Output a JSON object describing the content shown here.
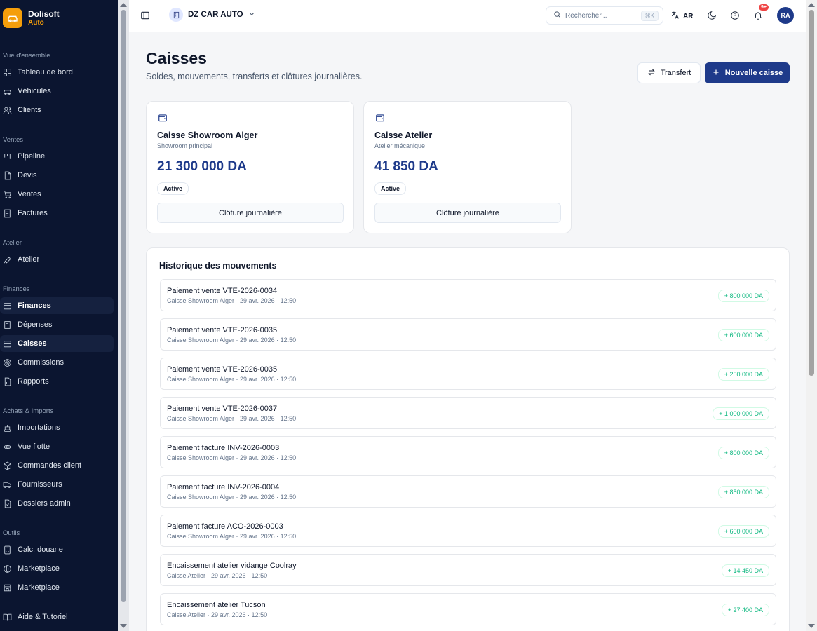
{
  "brand": {
    "name": "Dolisoft",
    "product": "Auto"
  },
  "sidebar": {
    "sections": [
      {
        "label": "Vue d'ensemble",
        "items": [
          {
            "label": "Tableau de bord",
            "icon": "dashboard-icon"
          },
          {
            "label": "Véhicules",
            "icon": "car-icon"
          },
          {
            "label": "Clients",
            "icon": "users-icon"
          }
        ]
      },
      {
        "label": "Ventes",
        "items": [
          {
            "label": "Pipeline",
            "icon": "pipeline-icon"
          },
          {
            "label": "Devis",
            "icon": "file-icon"
          },
          {
            "label": "Ventes",
            "icon": "cart-icon"
          },
          {
            "label": "Factures",
            "icon": "invoice-icon"
          }
        ]
      },
      {
        "label": "Atelier",
        "items": [
          {
            "label": "Atelier",
            "icon": "wrench-icon"
          }
        ]
      },
      {
        "label": "Finances",
        "items": [
          {
            "label": "Finances",
            "icon": "wallet-icon"
          },
          {
            "label": "Dépenses",
            "icon": "receipt-icon"
          },
          {
            "label": "Caisses",
            "icon": "cashbox-icon"
          },
          {
            "label": "Commissions",
            "icon": "target-icon"
          },
          {
            "label": "Rapports",
            "icon": "report-icon"
          }
        ]
      },
      {
        "label": "Achats & Imports",
        "items": [
          {
            "label": "Importations",
            "icon": "ship-icon"
          },
          {
            "label": "Vue flotte",
            "icon": "fleet-icon"
          },
          {
            "label": "Commandes client",
            "icon": "package-icon"
          },
          {
            "label": "Fournisseurs",
            "icon": "truck-icon"
          },
          {
            "label": "Dossiers admin",
            "icon": "folder-icon"
          }
        ]
      },
      {
        "label": "Outils",
        "items": [
          {
            "label": "Calc. douane",
            "icon": "calculator-icon"
          },
          {
            "label": "Marketplace",
            "icon": "globe-icon"
          },
          {
            "label": "Marketplace",
            "icon": "store-icon"
          }
        ]
      }
    ],
    "footer": {
      "label": "Aide & Tutoriel",
      "icon": "book-icon"
    }
  },
  "topbar": {
    "company": "DZ CAR AUTO",
    "search_placeholder": "Rechercher...",
    "search_shortcut": "⌘K",
    "lang": "AR",
    "notif_badge": "9+",
    "avatar": "RA"
  },
  "page": {
    "title": "Caisses",
    "subtitle": "Soldes, mouvements, transferts et clôtures journalières.",
    "btn_transfert": "Transfert",
    "btn_new": "Nouvelle caisse"
  },
  "caisses": [
    {
      "name": "Caisse Showroom Alger",
      "desc": "Showroom principal",
      "balance": "21 300 000 DA",
      "status": "Active",
      "close_label": "Clôture journalière"
    },
    {
      "name": "Caisse Atelier",
      "desc": "Atelier mécanique",
      "balance": "41 850 DA",
      "status": "Active",
      "close_label": "Clôture journalière"
    }
  ],
  "history": {
    "title": "Historique des mouvements",
    "items": [
      {
        "label": "Paiement vente VTE-2026-0034",
        "meta": "Caisse Showroom Alger · 29 avr. 2026 · 12:50",
        "amount": "+ 800 000 DA"
      },
      {
        "label": "Paiement vente VTE-2026-0035",
        "meta": "Caisse Showroom Alger · 29 avr. 2026 · 12:50",
        "amount": "+ 600 000 DA"
      },
      {
        "label": "Paiement vente VTE-2026-0035",
        "meta": "Caisse Showroom Alger · 29 avr. 2026 · 12:50",
        "amount": "+ 250 000 DA"
      },
      {
        "label": "Paiement vente VTE-2026-0037",
        "meta": "Caisse Showroom Alger · 29 avr. 2026 · 12:50",
        "amount": "+ 1 000 000 DA"
      },
      {
        "label": "Paiement facture INV-2026-0003",
        "meta": "Caisse Showroom Alger · 29 avr. 2026 · 12:50",
        "amount": "+ 800 000 DA"
      },
      {
        "label": "Paiement facture INV-2026-0004",
        "meta": "Caisse Showroom Alger · 29 avr. 2026 · 12:50",
        "amount": "+ 850 000 DA"
      },
      {
        "label": "Paiement facture ACO-2026-0003",
        "meta": "Caisse Showroom Alger · 29 avr. 2026 · 12:50",
        "amount": "+ 600 000 DA"
      },
      {
        "label": "Encaissement atelier vidange Coolray",
        "meta": "Caisse Atelier · 29 avr. 2026 · 12:50",
        "amount": "+ 14 450 DA"
      },
      {
        "label": "Encaissement atelier Tucson",
        "meta": "Caisse Atelier · 29 avr. 2026 · 12:50",
        "amount": "+ 27 400 DA"
      }
    ]
  },
  "colors": {
    "sidebar_bg": "#0b1530",
    "accent": "#1e3a8a",
    "brand": "#f59e0b",
    "positive": "#10b981"
  }
}
